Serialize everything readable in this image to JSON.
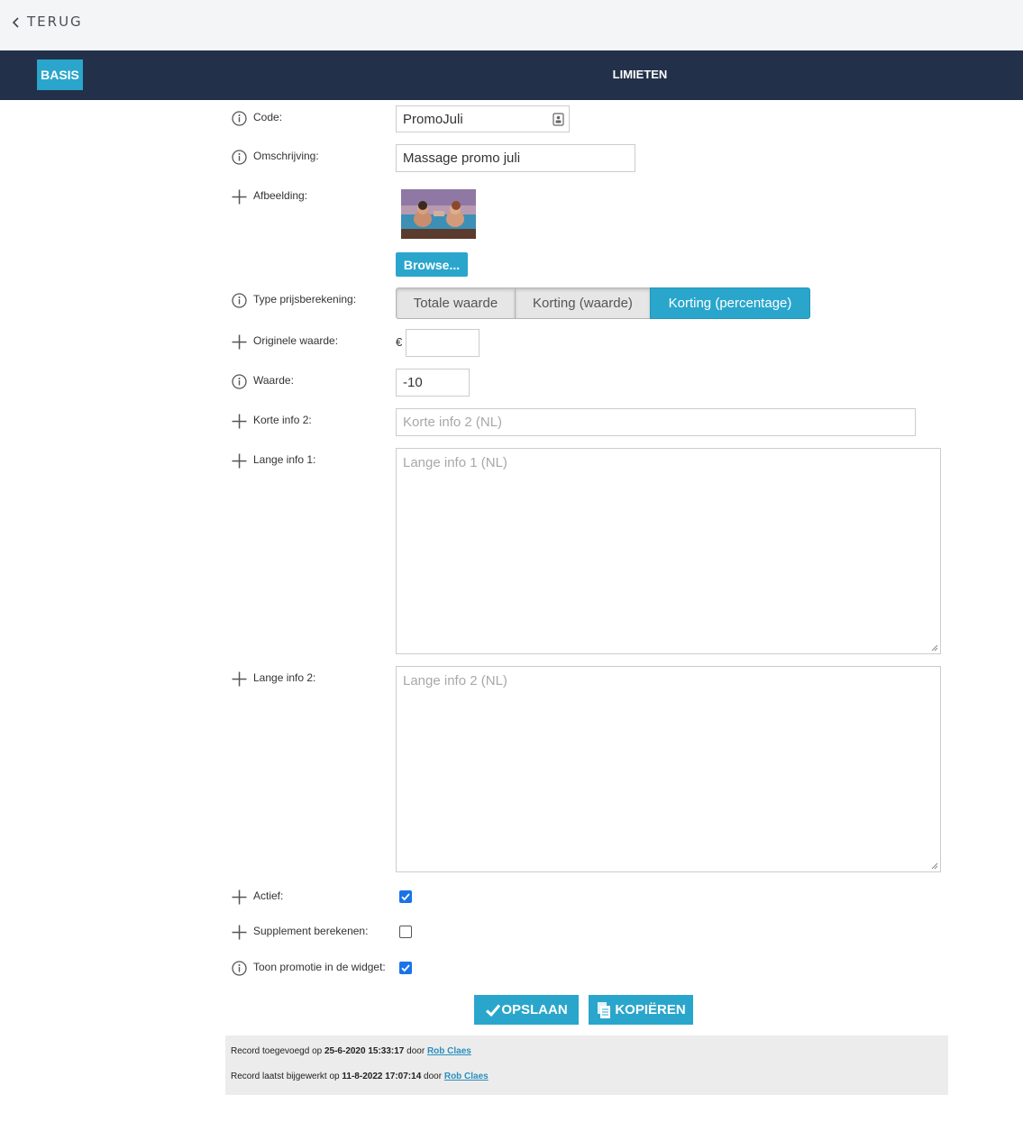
{
  "topbar": {
    "back_label": "TERUG"
  },
  "nav": {
    "tab_basis": "BASIS",
    "tab_limieten": "LIMIETEN"
  },
  "form": {
    "code_label": "Code:",
    "code_value": "PromoJuli",
    "omschrijving_label": "Omschrijving:",
    "omschrijving_value": "Massage promo juli",
    "afbeelding_label": "Afbeelding:",
    "browse_label": "Browse...",
    "type_label": "Type prijsberekening:",
    "type_options": [
      "Totale waarde",
      "Korting (waarde)",
      "Korting (percentage)"
    ],
    "type_selected": "Korting (percentage)",
    "originele_label": "Originele waarde:",
    "currency_symbol": "€",
    "originele_value": "",
    "waarde_label": "Waarde:",
    "waarde_value": "-10",
    "korte_info_label": "Korte info 2:",
    "korte_info_placeholder": "Korte info 2 (NL)",
    "lange_info1_label": "Lange info 1:",
    "lange_info1_placeholder": "Lange info 1 (NL)",
    "lange_info2_label": "Lange info 2:",
    "lange_info2_placeholder": "Lange info 2 (NL)",
    "actief_label": "Actief:",
    "actief_checked": true,
    "supplement_label": "Supplement berekenen:",
    "supplement_checked": false,
    "toon_label": "Toon promotie in de widget:",
    "toon_checked": true
  },
  "actions": {
    "save_label": "OPSLAAN",
    "copy_label": "KOPIËREN"
  },
  "footer": {
    "added_prefix": "Record toegevoegd op",
    "added_date": "25-6-2020 15:33:17",
    "added_by_word": "door",
    "added_user": "Rob Claes",
    "updated_prefix": "Record laatst bijgewerkt op",
    "updated_date": "11-8-2022 17:07:14",
    "updated_by_word": "door",
    "updated_user": "Rob Claes"
  },
  "colors": {
    "accent": "#2aa6cc",
    "navbar": "#22304a",
    "topbar": "#f4f5f6",
    "footer_bg": "#ececec",
    "checkbox": "#1a73e8"
  }
}
